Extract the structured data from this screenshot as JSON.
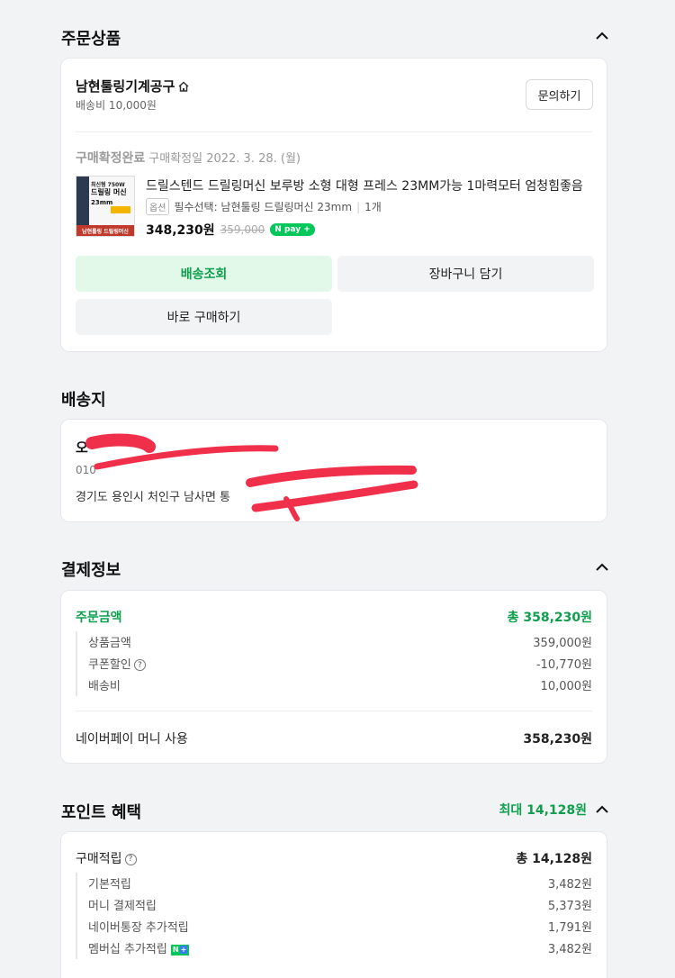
{
  "order_section": {
    "title": "주문상품",
    "store_name": "남현툴링기계공구",
    "shipping_fee": "배송비 10,000원",
    "inquiry_button": "문의하기",
    "status_label": "구매확정완료",
    "confirm_date": "구매확정일 2022. 3. 28. (월)",
    "product_name": "드릴스텐드 드릴링머신 보루방 소형 대형 프레스 23MM가능 1마력모터 엄청힘좋음",
    "option_tag": "옵션",
    "option_text": "필수선택: 남현툴링 드릴링머신 23mm",
    "quantity": "1개",
    "price": "348,230원",
    "original_price": "359,000",
    "npay_label": "pay",
    "thumb_line1": "최신형 750W",
    "thumb_line2": "드릴링 머신",
    "thumb_line3": "23mm",
    "thumb_footer": "남현툴링 드릴링머신",
    "buttons": {
      "track_delivery": "배송조회",
      "add_to_cart": "장바구니 담기",
      "buy_again": "바로 구매하기"
    }
  },
  "shipping_section": {
    "title": "배송지",
    "name": "오",
    "phone": "010",
    "address": "경기도 용인시 처인구 남사면 통"
  },
  "payment_section": {
    "title": "결제정보",
    "order_amount_label": "주문금액",
    "order_amount_value": "총 358,230원",
    "items": [
      {
        "label": "상품금액",
        "value": "359,000원"
      },
      {
        "label": "쿠폰할인",
        "value": "-10,770원"
      },
      {
        "label": "배송비",
        "value": "10,000원"
      }
    ],
    "method_label": "네이버페이 머니 사용",
    "method_value": "358,230원"
  },
  "points_section": {
    "title": "포인트 혜택",
    "max_label": "최대 14,128원",
    "accrual_label": "구매적립",
    "accrual_value": "총 14,128원",
    "items": [
      {
        "label": "기본적립",
        "value": "3,482원"
      },
      {
        "label": "머니 결제적립",
        "value": "5,373원"
      },
      {
        "label": "네이버통장 추가적립",
        "value": "1,791원"
      },
      {
        "label": "멤버십 추가적립",
        "value": "3,482원"
      }
    ]
  },
  "colors": {
    "accent_green": "#0e9f4d",
    "green_button_bg": "#e2f8e9",
    "page_bg": "#f2f3f5",
    "redaction": "#f0304a"
  },
  "icons": [
    "chevron-up-icon",
    "home-icon",
    "question-icon",
    "npay-icon",
    "nplus-icon"
  ]
}
